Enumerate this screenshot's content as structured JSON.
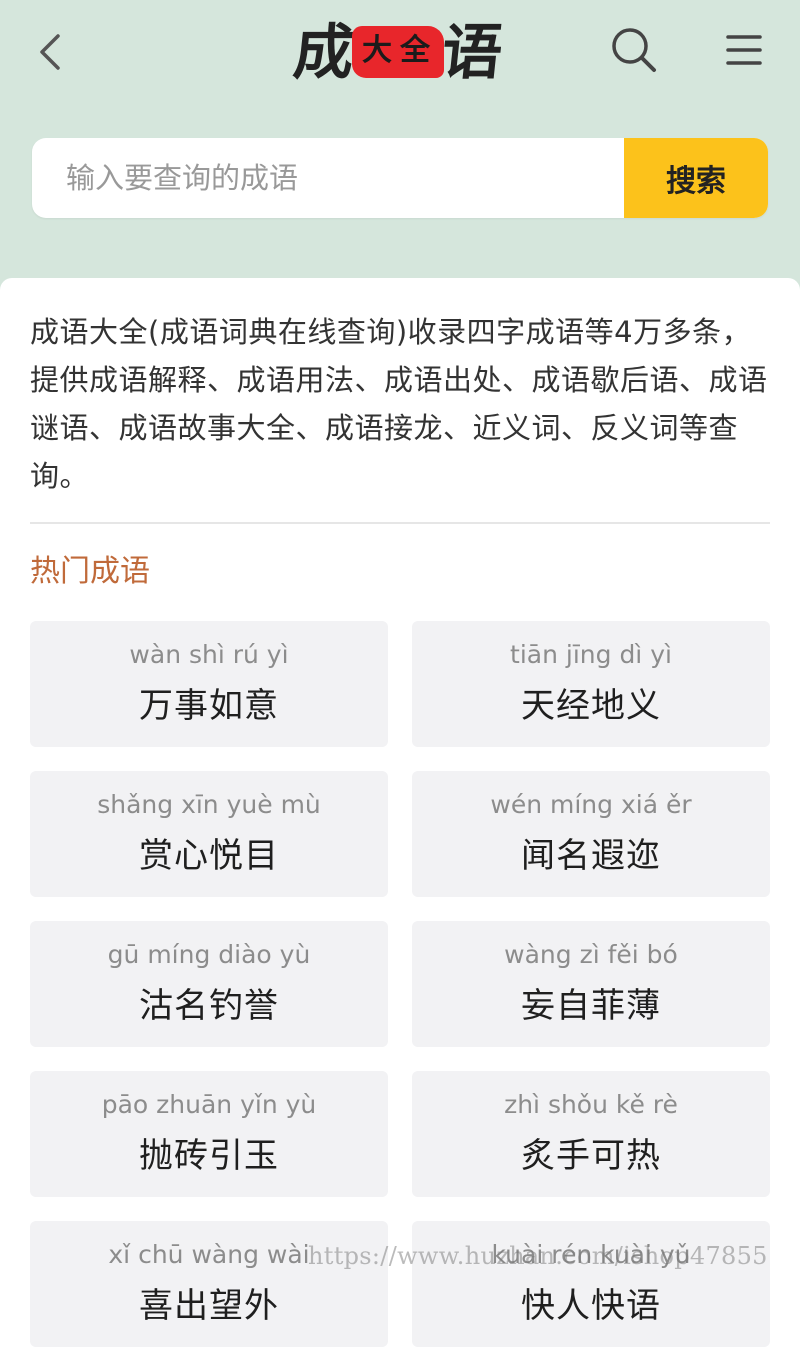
{
  "header": {
    "logo": {
      "chars": [
        "成",
        "语"
      ],
      "seal": [
        "大",
        "全"
      ]
    },
    "back_icon": "chevron-left-icon",
    "search_icon": "search-icon",
    "menu_icon": "hamburger-menu-icon"
  },
  "search": {
    "placeholder": "输入要查询的成语",
    "value": "",
    "button_label": "搜索",
    "button_color": "#fcc21b"
  },
  "intro": "成语大全(成语词典在线查询)收录四字成语等4万多条，提供成语解释、成语用法、成语出处、成语歇后语、成语谜语、成语故事大全、成语接龙、近义词、反义词等查询。",
  "hot": {
    "title": "热门成语",
    "title_color": "#c06a3a",
    "items": [
      {
        "pinyin": "wàn shì rú yì",
        "word": "万事如意"
      },
      {
        "pinyin": "tiān jīng dì yì",
        "word": "天经地义"
      },
      {
        "pinyin": "shǎng xīn yuè mù",
        "word": "赏心悦目"
      },
      {
        "pinyin": "wén míng xiá ěr",
        "word": "闻名遐迩"
      },
      {
        "pinyin": "gū míng diào yù",
        "word": "沽名钓誉"
      },
      {
        "pinyin": "wàng zì fěi bó",
        "word": "妄自菲薄"
      },
      {
        "pinyin": "pāo zhuān yǐn yù",
        "word": "抛砖引玉"
      },
      {
        "pinyin": "zhì shǒu kě rè",
        "word": "炙手可热"
      },
      {
        "pinyin": "xǐ chū wàng wài",
        "word": "喜出望外"
      },
      {
        "pinyin": "kuài rén kuài yǔ",
        "word": "快人快语"
      }
    ]
  },
  "watermark": "https://www.huzhan.com/ishop47855",
  "colors": {
    "header_bg": "#d5e6dc",
    "accent": "#fcc21b",
    "card_bg": "#f2f2f4"
  }
}
